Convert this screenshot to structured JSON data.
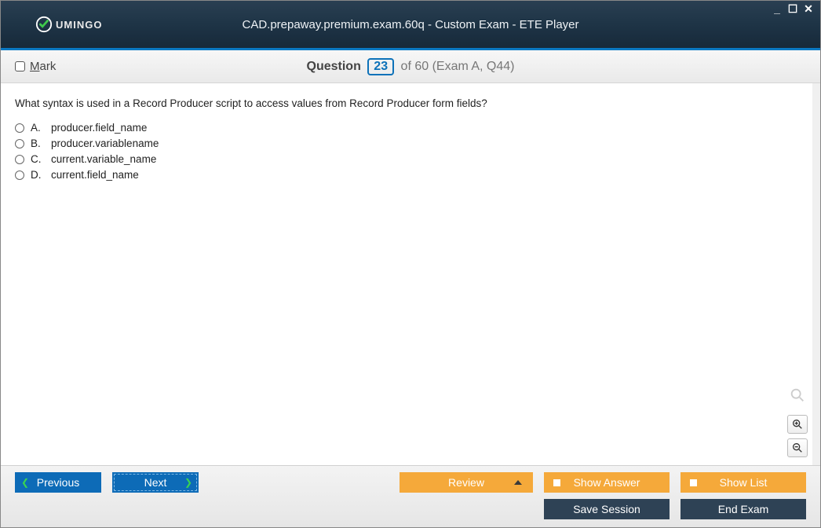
{
  "brand": "UMINGO",
  "window_title": "CAD.prepaway.premium.exam.60q - Custom Exam - ETE Player",
  "mark_label": "Mark",
  "question_label": "Question",
  "question_number": "23",
  "question_total_suffix": "of 60 (Exam A, Q44)",
  "question_text": "What syntax is used in a Record Producer script to access values from Record Producer form fields?",
  "options": [
    {
      "letter": "A.",
      "text": "producer.field_name"
    },
    {
      "letter": "B.",
      "text": "producer.variablename"
    },
    {
      "letter": "C.",
      "text": "current.variable_name"
    },
    {
      "letter": "D.",
      "text": "current.field_name"
    }
  ],
  "buttons": {
    "previous": "Previous",
    "next": "Next",
    "review": "Review",
    "show_answer": "Show Answer",
    "show_list": "Show List",
    "save_session": "Save Session",
    "end_exam": "End Exam"
  }
}
